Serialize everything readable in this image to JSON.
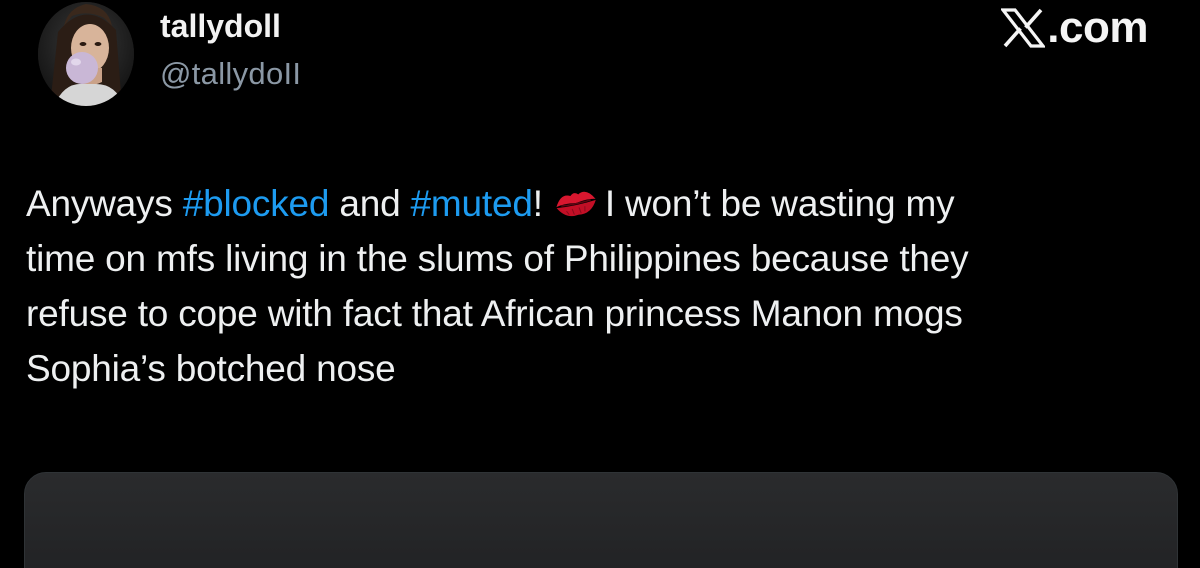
{
  "author": {
    "display_name": "tallydoll",
    "handle": "@tallydoII",
    "avatar_icon": "profile-photo"
  },
  "brand": {
    "icon": "x-logo-icon",
    "text": ".com"
  },
  "tweet": {
    "line1": {
      "t1": "Anyways ",
      "tag1": "#blocked",
      "t2": " and ",
      "tag2": "#muted",
      "t3": "!",
      "emoji_icon": "kiss-mark-icon",
      "t4": "I won’t be wasting my"
    },
    "line2": "time on mfs living in the slums of Philippines because they",
    "line3": "refuse to cope with fact that African princess Manon mogs",
    "line4": "Sophia’s botched nose"
  },
  "colors": {
    "background": "#000000",
    "text": "#e7e9ea",
    "secondary_text": "#8b98a5",
    "hashtag": "#1d9bf0",
    "media_card": "#252628"
  }
}
